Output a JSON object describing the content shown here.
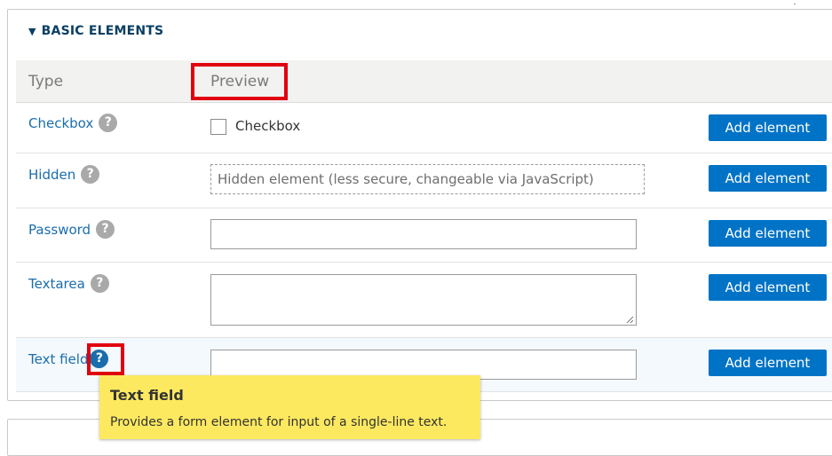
{
  "section": {
    "title": "BASIC ELEMENTS",
    "toggle_icon": "triangle-down-icon"
  },
  "table": {
    "headers": {
      "type": "Type",
      "preview": "Preview"
    },
    "rows": [
      {
        "type": "Checkbox",
        "preview_label": "Checkbox",
        "button": "Add element"
      },
      {
        "type": "Hidden",
        "preview_text": "Hidden element (less secure, changeable via JavaScript)",
        "button": "Add element"
      },
      {
        "type": "Password",
        "button": "Add element"
      },
      {
        "type": "Textarea",
        "button": "Add element"
      },
      {
        "type": "Text field",
        "button": "Add element"
      }
    ],
    "help_glyph": "?"
  },
  "tooltip": {
    "title": "Text field",
    "body": "Provides a form element for input of a single-line text."
  },
  "colors": {
    "accent": "#0073c6",
    "link": "#1a6dad",
    "highlight": "#e1000f",
    "tooltip_bg": "#fde95f"
  }
}
